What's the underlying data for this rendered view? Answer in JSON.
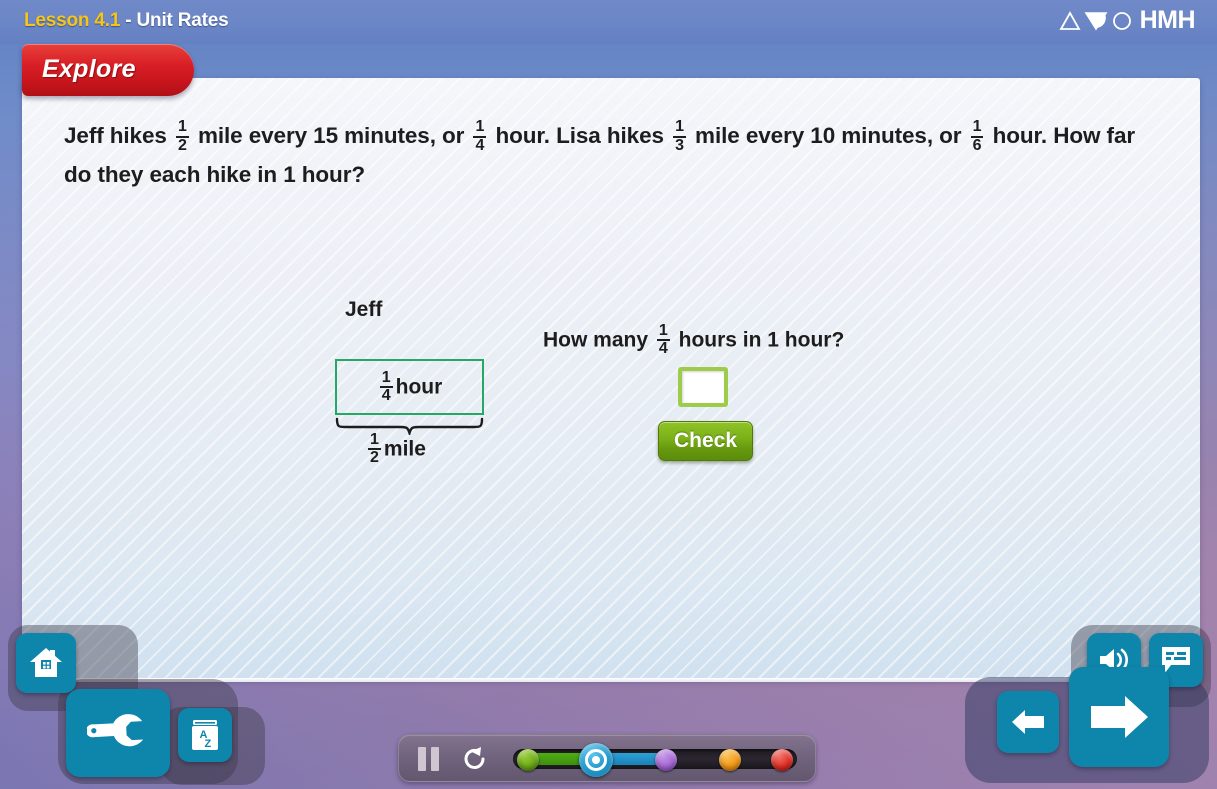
{
  "header": {
    "lesson_number": "Lesson 4.1",
    "separator": " - ",
    "lesson_name": "Unit Rates",
    "logo_text": "HMH",
    "logo_marks": [
      "triangle-icon",
      "wedge-icon",
      "circle-icon"
    ],
    "colors": {
      "bar": "#6d8bc9",
      "lesson_number": "#f5c518",
      "lesson_name": "#ffffff"
    }
  },
  "tab": {
    "label": "Explore",
    "color": "#d81f26"
  },
  "problem": {
    "line1_a": "Jeff hikes",
    "frac1": {
      "num": "1",
      "den": "2"
    },
    "line1_b": "mile every 15 minutes, or",
    "frac2": {
      "num": "1",
      "den": "4"
    },
    "line1_c": "hour. Lisa hikes",
    "frac3": {
      "num": "1",
      "den": "3"
    },
    "line1_d": "mile",
    "line2_a": "every 10 minutes, or",
    "frac4": {
      "num": "1",
      "den": "6"
    },
    "line2_b": "hour. How far do they each hike in 1 hour?"
  },
  "diagram": {
    "person_label": "Jeff",
    "box": {
      "frac": {
        "num": "1",
        "den": "4"
      },
      "unit": "hour",
      "border_color": "#24a867"
    },
    "brace": {
      "frac": {
        "num": "1",
        "den": "2"
      },
      "unit": "mile"
    }
  },
  "question": {
    "text_a": "How many",
    "frac": {
      "num": "1",
      "den": "4"
    },
    "text_b": "hours in 1 hour?",
    "answer_value": "",
    "answer_placeholder": "",
    "check_label": "Check",
    "check_color": "#7cb218",
    "input_border_color": "#9ccc4a"
  },
  "toolbar_left": {
    "buttons": [
      {
        "name": "home-button",
        "icon": "home-icon"
      },
      {
        "name": "tools-button",
        "icon": "wrench-icon"
      },
      {
        "name": "glossary-button",
        "icon": "glossary-book-icon",
        "letters": {
          "a": "A",
          "z": "Z"
        }
      }
    ],
    "color": "#0e86ab"
  },
  "toolbar_right": {
    "buttons": [
      {
        "name": "audio-button",
        "icon": "speaker-icon"
      },
      {
        "name": "captions-button",
        "icon": "caption-bubble-icon"
      },
      {
        "name": "previous-button",
        "icon": "arrow-left-icon"
      },
      {
        "name": "next-button",
        "icon": "arrow-right-icon"
      }
    ],
    "color": "#0e86ab"
  },
  "progress": {
    "pause_icon": "pause-icon",
    "replay_icon": "replay-icon",
    "current_step": 2,
    "total_steps": 5,
    "steps": [
      {
        "index": 1,
        "color": "#6aa814",
        "state": "complete"
      },
      {
        "index": 2,
        "color": "#2196ca",
        "state": "current"
      },
      {
        "index": 3,
        "color": "#a364d4",
        "state": "upcoming"
      },
      {
        "index": 4,
        "color": "#f09513",
        "state": "upcoming"
      },
      {
        "index": 5,
        "color": "#e02a21",
        "state": "upcoming"
      }
    ]
  }
}
